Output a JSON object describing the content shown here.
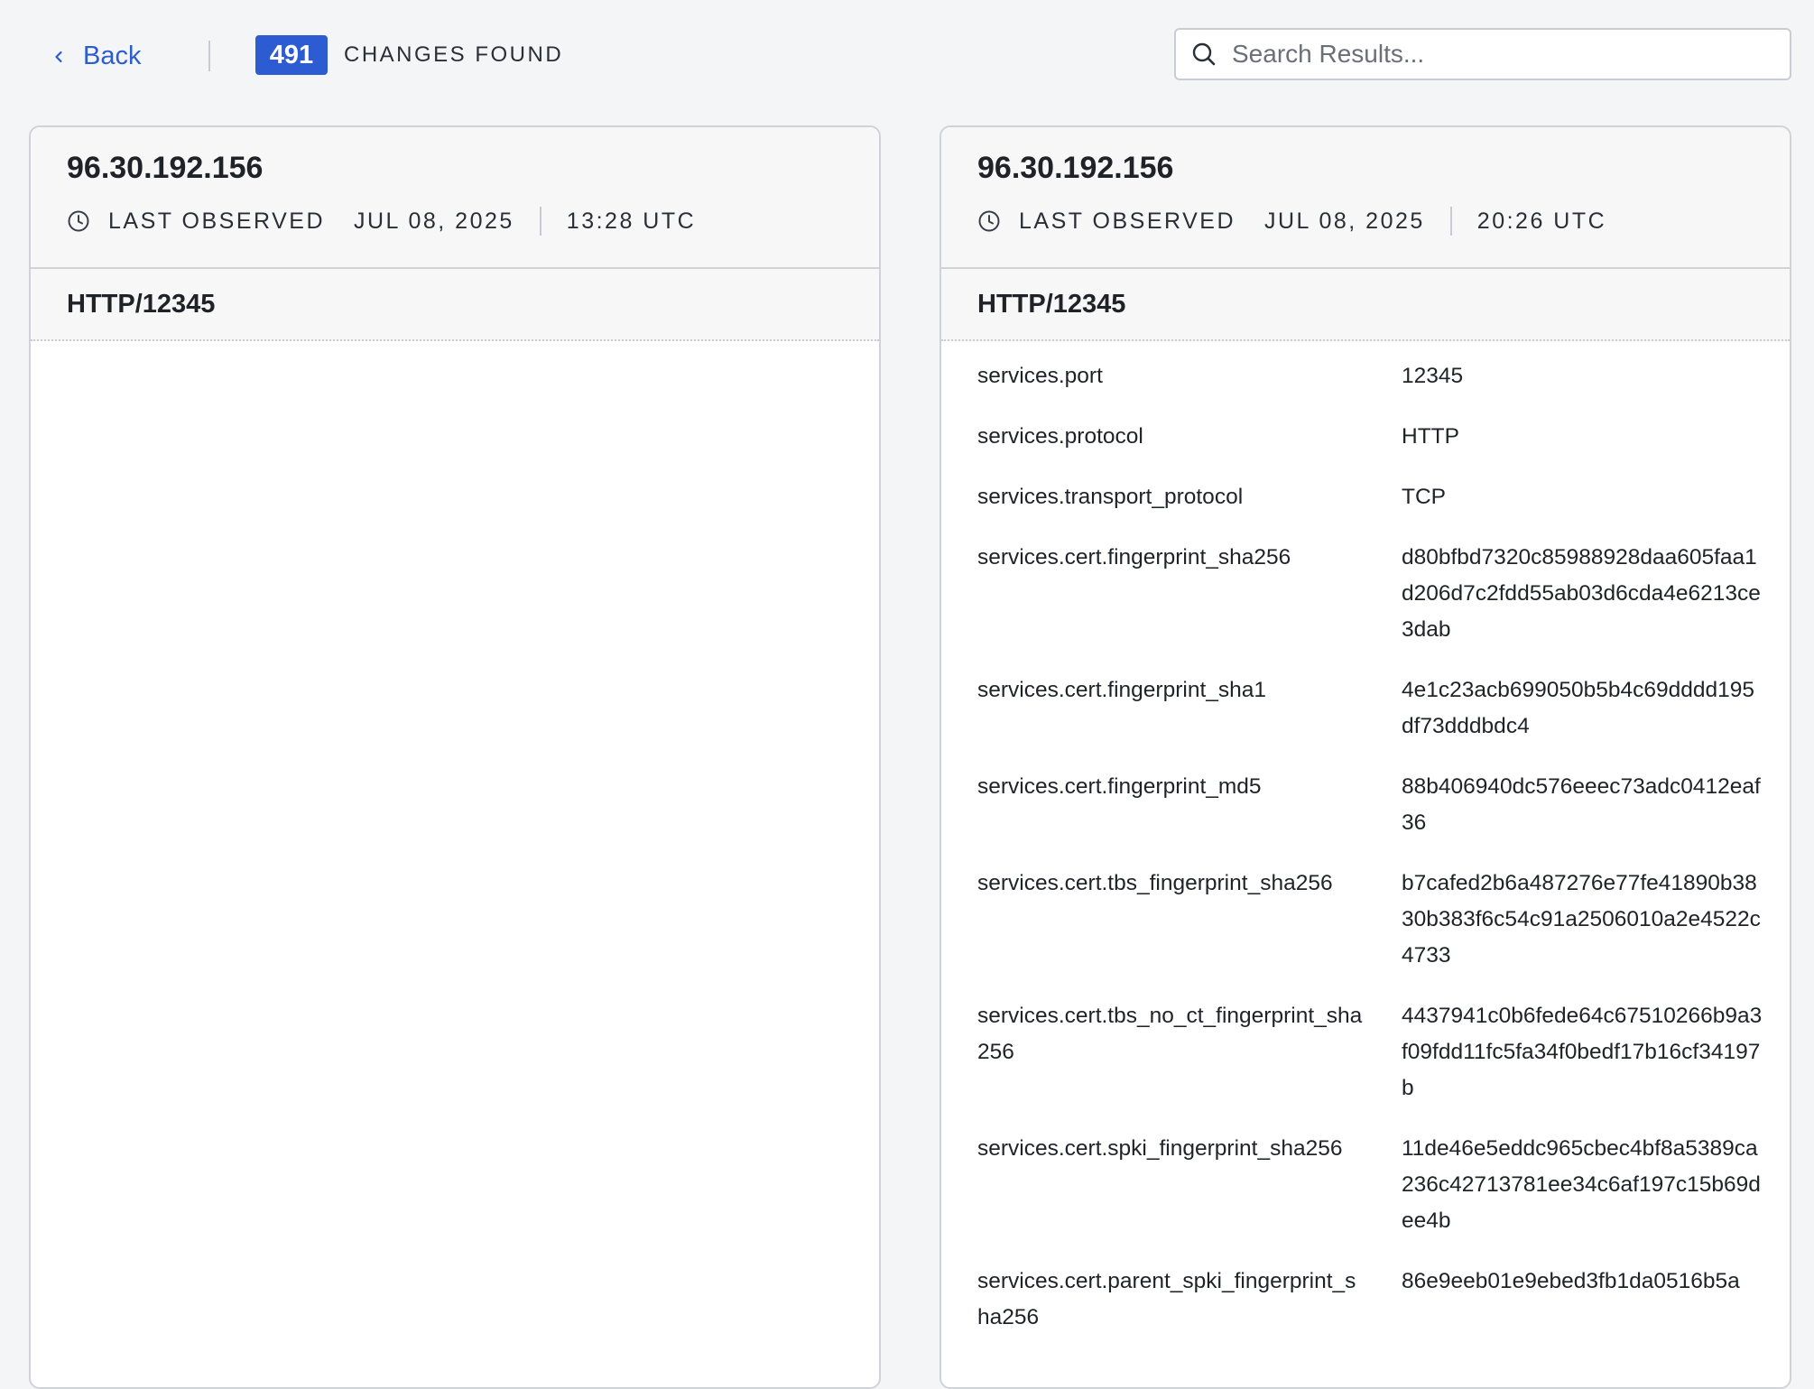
{
  "topbar": {
    "back_label": "Back",
    "change_count": "491",
    "changes_label": "CHANGES FOUND",
    "search_placeholder": "Search Results..."
  },
  "left_panel": {
    "ip": "96.30.192.156",
    "last_observed_label": "LAST OBSERVED",
    "date": "JUL 08, 2025",
    "time": "13:28 UTC",
    "section_title": "HTTP/12345"
  },
  "right_panel": {
    "ip": "96.30.192.156",
    "last_observed_label": "LAST OBSERVED",
    "date": "JUL 08, 2025",
    "time": "20:26 UTC",
    "section_title": "HTTP/12345",
    "fields": [
      {
        "key": "services.port",
        "value": "12345"
      },
      {
        "key": "services.protocol",
        "value": "HTTP"
      },
      {
        "key": "services.transport_protocol",
        "value": "TCP"
      },
      {
        "key": "services.cert.fingerprint_sha256",
        "value": "d80bfbd7320c85988928daa605faa1d206d7c2fdd55ab03d6cda4e6213ce3dab"
      },
      {
        "key": "services.cert.fingerprint_sha1",
        "value": "4e1c23acb699050b5b4c69dddd195df73dddbdc4"
      },
      {
        "key": "services.cert.fingerprint_md5",
        "value": "88b406940dc576eeec73adc0412eaf36"
      },
      {
        "key": "services.cert.tbs_fingerprint_sha256",
        "value": "b7cafed2b6a487276e77fe41890b3830b383f6c54c91a2506010a2e4522c4733"
      },
      {
        "key": "services.cert.tbs_no_ct_fingerprint_sha256",
        "value": "4437941c0b6fede64c67510266b9a3f09fdd11fc5fa34f0bedf17b16cf34197b"
      },
      {
        "key": "services.cert.spki_fingerprint_sha256",
        "value": "11de46e5eddc965cbec4bf8a5389ca236c42713781ee34c6af197c15b69dee4b"
      },
      {
        "key": "services.cert.parent_spki_fingerprint_sha256",
        "value": "86e9eeb01e9ebed3fb1da0516b5a"
      }
    ]
  },
  "icons": {
    "back": "chevron-left-icon",
    "search": "search-icon",
    "clock": "clock-icon"
  },
  "colors": {
    "accent": "#2d5bd1",
    "background": "#f4f5f7",
    "border": "#cfd2d7"
  }
}
